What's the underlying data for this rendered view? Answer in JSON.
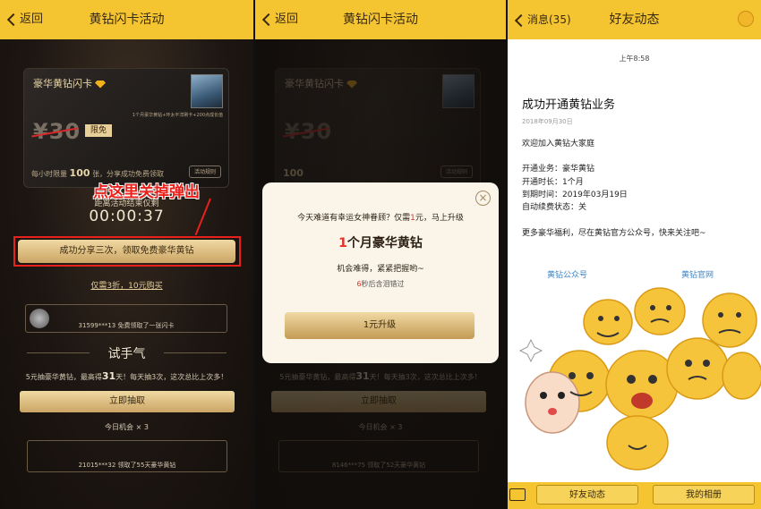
{
  "panel1": {
    "back": "返回",
    "title": "黄钻闪卡活动",
    "card": {
      "title": "豪华黄钻闪卡",
      "benefits": "1个月豪华黄钻+环太平洋刷卡+200点成长值",
      "price": "¥30",
      "free_badge": "限免",
      "limit_pre": "每小时限量",
      "limit_num": "100",
      "limit_post": "张，分享成功免费领取",
      "rules": "活动规则"
    },
    "annotation": "点这里关掉弹出",
    "countdown_label": "距离活动结束仅剩",
    "countdown": "00:00:37",
    "share_button": "成功分享三次，领取免费豪华黄钻",
    "discount_link": "仅需3折，10元购买",
    "feed1": "31599***13 免费领取了一张闪卡",
    "try_title": "试手气",
    "try_desc_pre": "5元抽豪华黄钻，最高得",
    "try_desc_num": "31",
    "try_desc_post": "天！每天抽3次，这次总比上次多！",
    "draw_button": "立即抽取",
    "chance": "今日机会 × 3",
    "feed2": "21015***32 领取了55天豪华黄钻"
  },
  "panel2": {
    "back": "返回",
    "title": "黄钻闪卡活动",
    "card_title": "豪华黄钻闪卡",
    "price": "¥30",
    "limit_num": "100",
    "rules": "活动规则",
    "try_desc_pre": "5元抽豪华黄钻，最高得",
    "try_desc_num": "31",
    "try_desc_post": "天！每天抽3次，这次总比上次多！",
    "draw_button": "立即抽取",
    "chance": "今日机会 × 3",
    "feed": "8146***75 领取了52天豪华黄钻",
    "modal": {
      "close": "×",
      "question_pre": "今天难道有幸运女神眷顾？仅需",
      "question_num": "1",
      "question_post": "元，马上升级",
      "big_num": "1",
      "big_text": "个月豪华黄钻",
      "rare": "机会难得，紧紧把握哟~",
      "seconds_num": "6",
      "seconds_text": "秒后含泪错过",
      "upgrade_button": "1元升级"
    }
  },
  "panel3": {
    "back": "消息(35)",
    "title": "好友动态",
    "time": "上午8:58",
    "msg_title": "成功开通黄钻业务",
    "msg_date": "2018年09月30日",
    "welcome": "欢迎加入黄钻大家庭",
    "lines": [
      "开通业务：豪华黄钻",
      "开通时长：1个月",
      "到期时间：2019年03月19日",
      "自动续费状态：关"
    ],
    "more": "更多豪华福利，尽在黄钻官方公众号，快来关注吧~",
    "tab_left": "黄钻公众号",
    "tab_right": "黄钻官网",
    "bottom_left": "好友动态",
    "bottom_right": "我的相册"
  },
  "colors": {
    "header": "#f5c531",
    "gold": "#e7cf9a",
    "red": "#e8211c",
    "link_blue": "#3d86c6"
  }
}
